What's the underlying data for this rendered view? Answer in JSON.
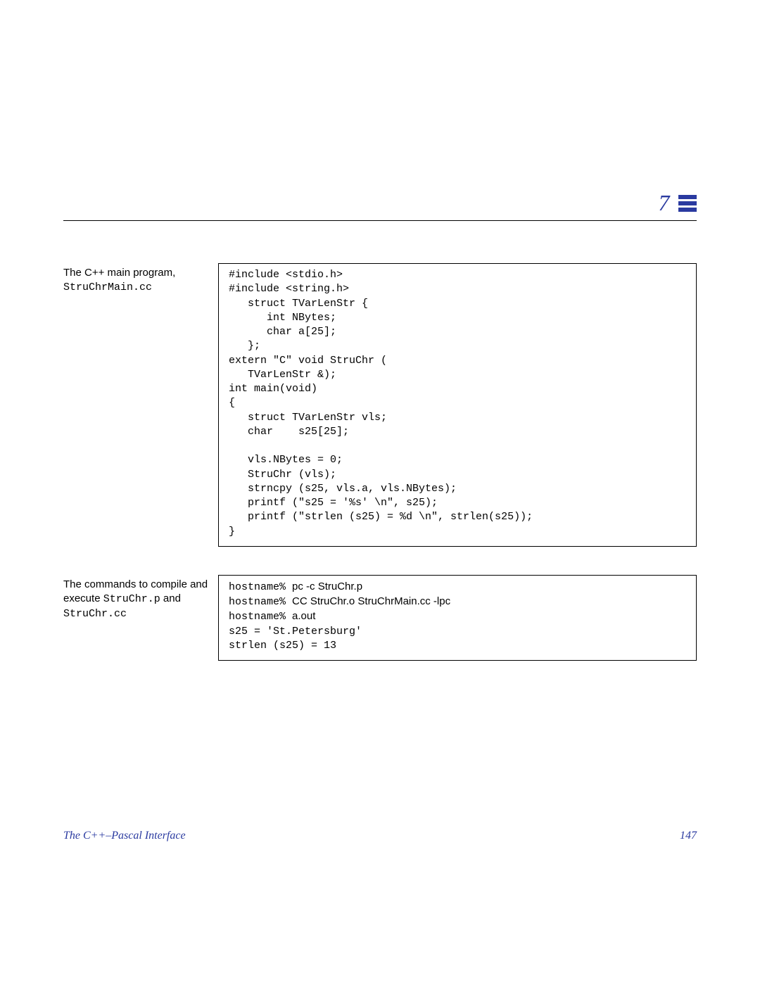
{
  "chapter_number": "7",
  "block1": {
    "label_line1": "The C++ main program,",
    "label_line2": "StruChrMain.cc",
    "code": "#include <stdio.h>\n#include <string.h>\n   struct TVarLenStr {\n      int NBytes;\n      char a[25];\n   };\nextern \"C\" void StruChr (\n   TVarLenStr &);\nint main(void)\n{\n   struct TVarLenStr vls;\n   char    s25[25];\n\n   vls.NBytes = 0;\n   StruChr (vls);\n   strncpy (s25, vls.a, vls.NBytes);\n   printf (\"s25 = '%s' \\n\", s25);\n   printf (\"strlen (s25) = %d \\n\", strlen(s25));\n}"
  },
  "block2": {
    "label_line1": "The commands to compile and",
    "label_line2a": "execute ",
    "label_line2b": "StruChr.p",
    "label_line2c": " and",
    "label_line3": "StruChr.cc",
    "prompt": "hostname%",
    "cmd1": "pc -c StruChr.p",
    "cmd2": "CC StruChr.o StruChrMain.cc -lpc",
    "cmd3": "a.out",
    "out1": "s25 = 'St.Petersburg'",
    "out2": "strlen (s25) = 13"
  },
  "footer_title": "The C++–Pascal Interface",
  "page_number": "147"
}
